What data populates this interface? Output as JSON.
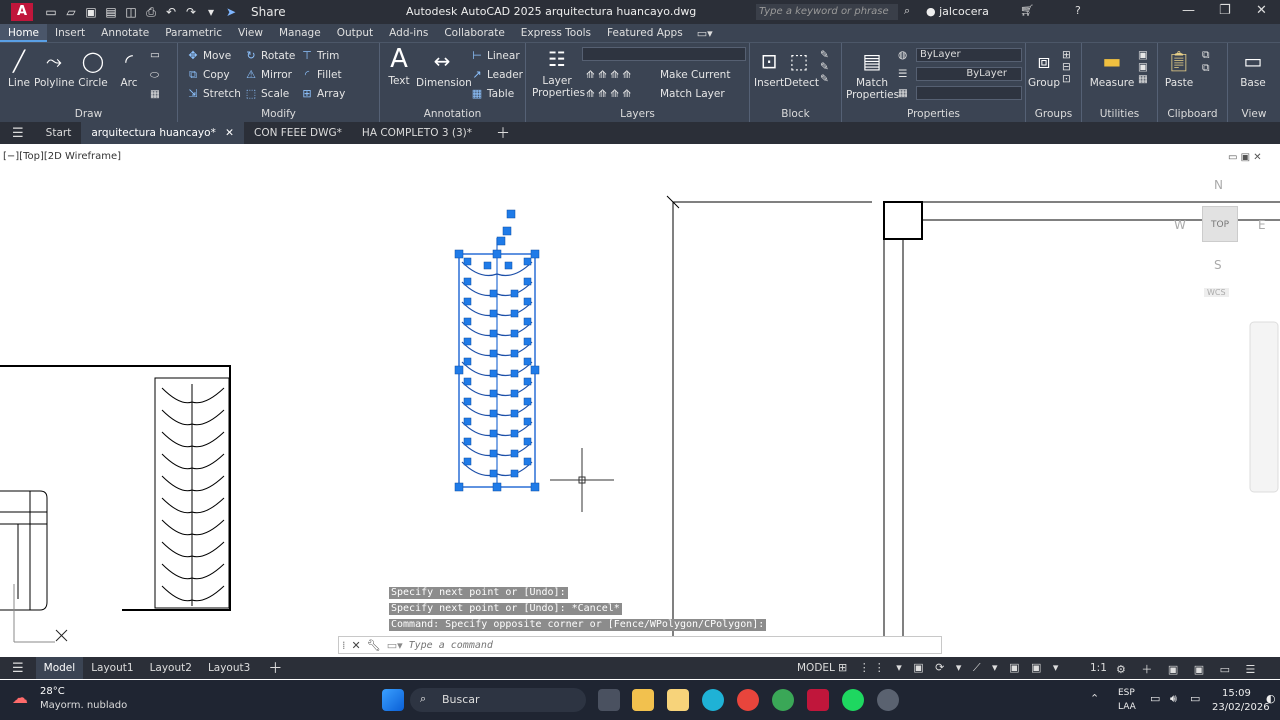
{
  "titlebar": {
    "app_logo": "A",
    "share_label": "Share",
    "window_title": "Autodesk AutoCAD 2025    arquitectura huancayo.dwg",
    "search_placeholder": "Type a keyword or phrase",
    "user_name": "jalcocera"
  },
  "menu_tabs": [
    "Home",
    "Insert",
    "Annotate",
    "Parametric",
    "View",
    "Manage",
    "Output",
    "Add-ins",
    "Collaborate",
    "Express Tools",
    "Featured Apps"
  ],
  "ribbon": {
    "draw": {
      "title": "Draw",
      "tools": [
        "Line",
        "Polyline",
        "Circle",
        "Arc"
      ]
    },
    "modify": {
      "title": "Modify",
      "tools": [
        "Move",
        "Rotate",
        "Trim",
        "Copy",
        "Mirror",
        "Fillet",
        "Stretch",
        "Scale",
        "Array"
      ]
    },
    "annotation": {
      "title": "Annotation",
      "text": "Text",
      "dimension": "Dimension",
      "linear": "Linear",
      "leader": "Leader",
      "table": "Table"
    },
    "layers": {
      "title": "Layers",
      "layer_properties": "Layer Properties",
      "make_current": "Make Current",
      "match_layer": "Match Layer"
    },
    "block": {
      "title": "Block",
      "insert": "Insert",
      "detect": "Detect"
    },
    "properties": {
      "title": "Properties",
      "match": "Match Properties",
      "color": "ByLayer",
      "linetype": "ByLayer"
    },
    "groups": {
      "title": "Groups",
      "group": "Group"
    },
    "utilities": {
      "title": "Utilities",
      "measure": "Measure"
    },
    "clipboard": {
      "title": "Clipboard",
      "paste": "Paste"
    },
    "view": {
      "title": "View",
      "base": "Base"
    }
  },
  "doc_tabs": [
    "Start",
    "arquitectura huancayo*",
    "CON FEEE DWG*",
    "HA COMPLETO 3 (3)*"
  ],
  "viewport_label": "[−][Top][2D Wireframe]",
  "viewcube": {
    "n": "N",
    "s": "S",
    "e": "E",
    "w": "W",
    "top": "TOP",
    "wcs": "WCS"
  },
  "command_history": [
    "Specify next point or [Undo]:",
    "Specify next point or [Undo]: *Cancel*",
    "Command: Specify opposite corner or [Fence/WPolygon/CPolygon]:"
  ],
  "command_placeholder": "Type a command",
  "layout_tabs": [
    "Model",
    "Layout1",
    "Layout2",
    "Layout3"
  ],
  "status": {
    "model": "MODEL",
    "scale": "1:1"
  },
  "taskbar": {
    "weather_temp": "28°C",
    "weather_desc": "Mayorm. nublado",
    "search_label": "Buscar",
    "lang_top": "ESP",
    "lang_bottom": "LAA",
    "time": "15:09",
    "date": "23/02/2026"
  }
}
